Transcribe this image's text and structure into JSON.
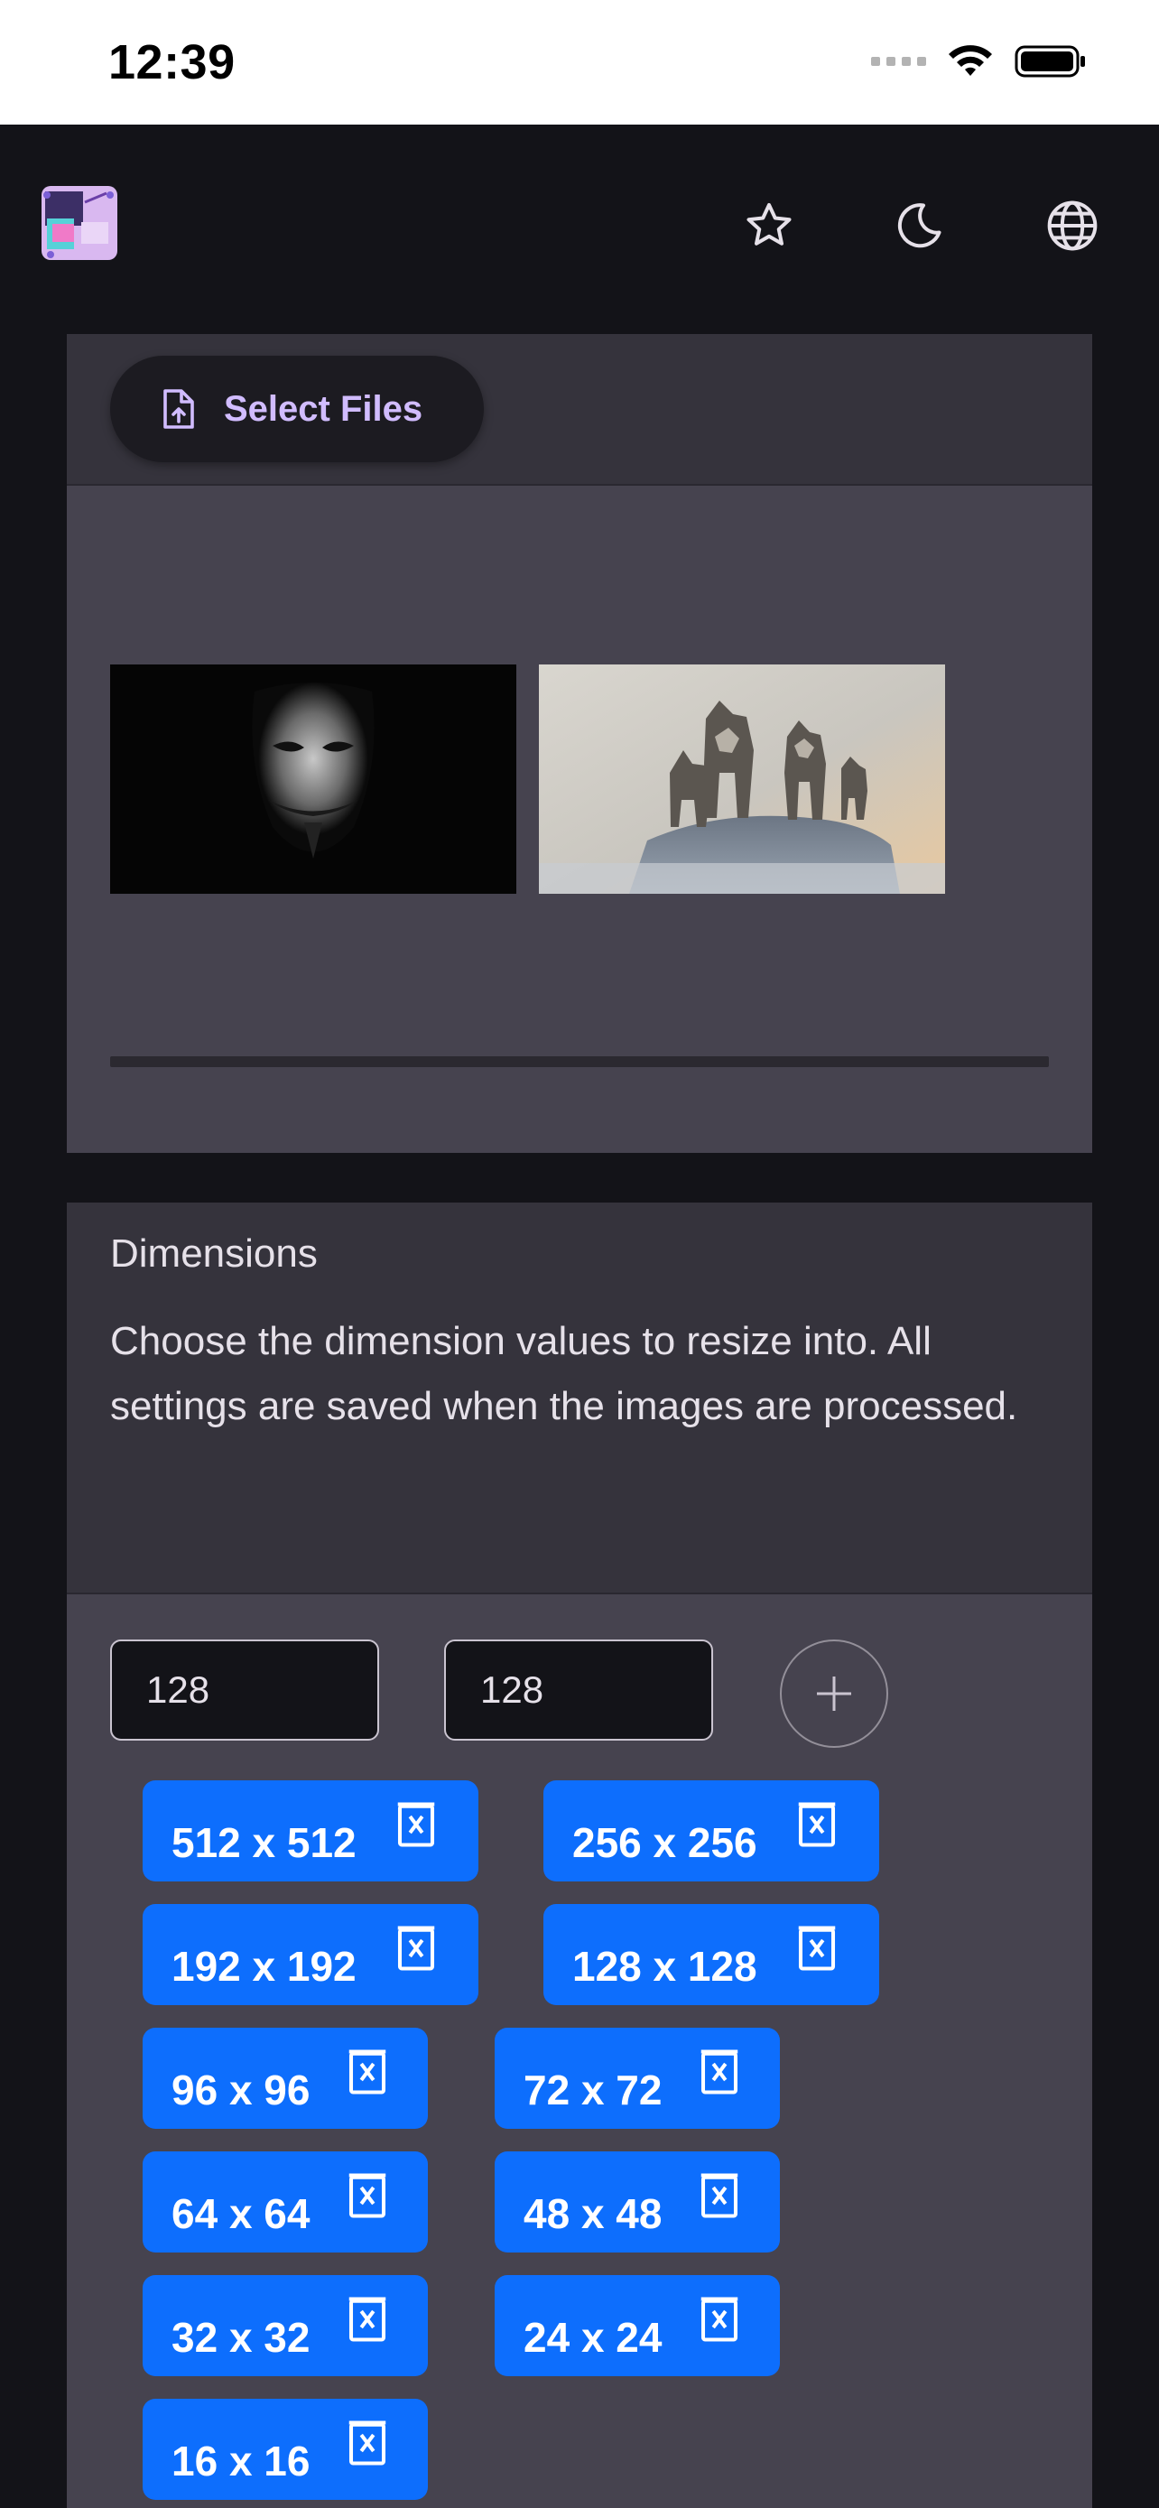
{
  "status_bar": {
    "time": "12:39"
  },
  "app_bar": {
    "icons": [
      "app-logo",
      "star-icon",
      "moon-icon",
      "globe-icon"
    ]
  },
  "upload": {
    "select_files_label": "Select Files",
    "images": [
      "anonymous-mask-image",
      "wolves-image"
    ]
  },
  "dimensions": {
    "title": "Dimensions",
    "description": "Choose the dimension values to resize into. All settings are saved when the images are processed.",
    "width_value": "128",
    "height_value": "128",
    "chips": [
      "512 x 512",
      "256 x 256",
      "192 x 192",
      "128 x 128",
      "96 x 96",
      "72 x 72",
      "64 x 64",
      "48 x 48",
      "32 x 32",
      "24 x 24",
      "16 x 16"
    ]
  },
  "colors": {
    "background": "#131318",
    "card": "#46434f",
    "card_header": "#35333c",
    "chip": "#0d6efd",
    "accent_text": "#d1bcff"
  }
}
